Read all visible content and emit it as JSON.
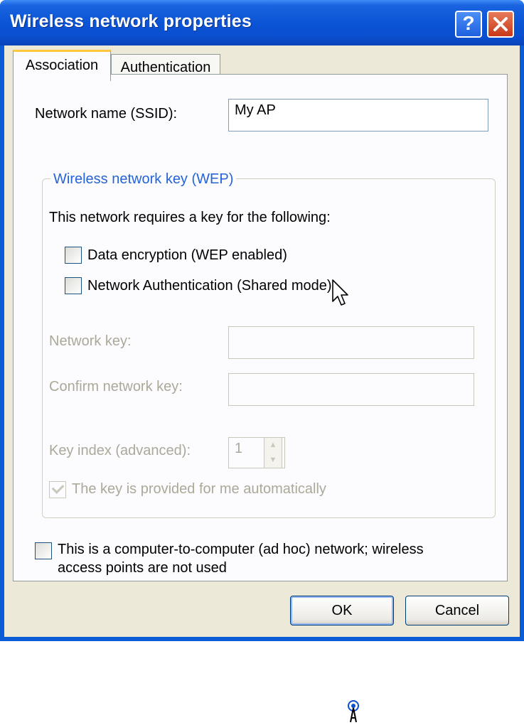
{
  "window": {
    "title": "Wireless network properties",
    "help_label": "?",
    "close_label": "✕"
  },
  "tabs": [
    {
      "label": "Association",
      "active": true
    },
    {
      "label": "Authentication",
      "active": false
    }
  ],
  "association": {
    "ssid_label": "Network name (SSID):",
    "ssid_value": "My AP",
    "group_title": "Wireless network key (WEP)",
    "requires_text": "This network requires a key for the following:",
    "data_encryption": {
      "label": "Data encryption (WEP enabled)",
      "checked": false
    },
    "network_auth": {
      "label": "Network Authentication (Shared mode)",
      "checked": false
    },
    "network_key_label": "Network key:",
    "network_key_value": "",
    "confirm_key_label": "Confirm network key:",
    "confirm_key_value": "",
    "key_index_label": "Key index (advanced):",
    "key_index_value": "1",
    "auto_key": {
      "label": "The key is provided for me automatically",
      "checked": true,
      "disabled": true
    },
    "adhoc": {
      "label_line1": "This is a computer-to-computer (ad hoc) network; wireless",
      "label_line2": "access points are not used",
      "checked": false
    }
  },
  "buttons": {
    "ok": "OK",
    "cancel": "Cancel"
  },
  "colors": {
    "titlebar": "#0a54d6",
    "client": "#ece9d8",
    "group_title": "#2463d8",
    "disabled_text": "#aca899",
    "tab_highlight": "#ffc83c"
  },
  "icons": {
    "cursor": "arrow-cursor-icon",
    "tray": "wireless-tray-icon"
  }
}
